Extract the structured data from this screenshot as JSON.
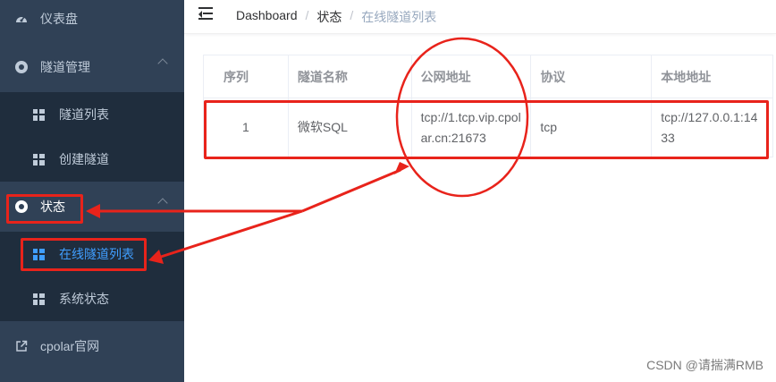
{
  "sidebar": {
    "items": [
      {
        "label": "仪表盘"
      },
      {
        "label": "隧道管理"
      },
      {
        "label": "隧道列表"
      },
      {
        "label": "创建隧道"
      },
      {
        "label": "状态"
      },
      {
        "label": "在线隧道列表"
      },
      {
        "label": "系统状态"
      },
      {
        "label": "cpolar官网"
      }
    ]
  },
  "breadcrumb": [
    "Dashboard",
    "状态",
    "在线隧道列表"
  ],
  "breadcrumb_sep": "/",
  "table": {
    "headers": [
      "序列",
      "隧道名称",
      "公网地址",
      "协议",
      "本地地址"
    ],
    "rows": [
      [
        "1",
        "微软SQL",
        "tcp://1.tcp.vip.cpolar.cn:21673",
        "tcp",
        "tcp://127.0.0.1:1433"
      ]
    ]
  },
  "watermark": "CSDN @请揣满RMB",
  "colors": {
    "sidebar_bg": "#304156",
    "submenu_bg": "#1f2d3d",
    "active": "#409eff",
    "annotation": "#e8231b"
  }
}
